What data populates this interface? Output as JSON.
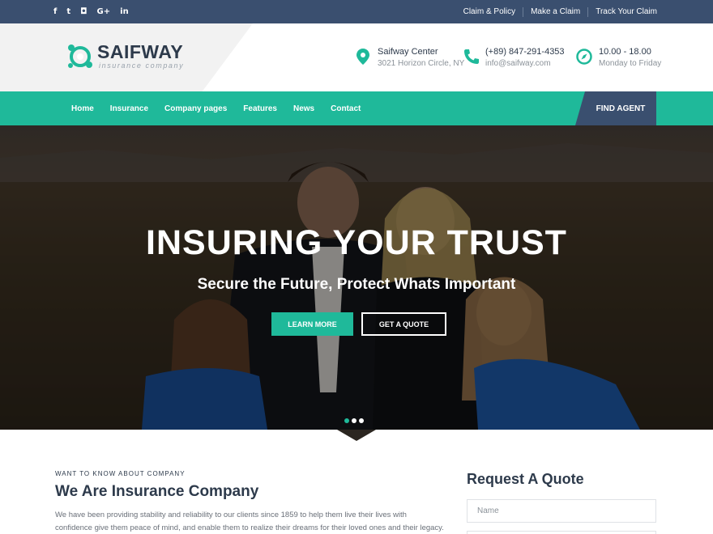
{
  "topbar": {
    "social": [
      {
        "icon": "facebook-icon",
        "glyph": "f"
      },
      {
        "icon": "twitter-icon",
        "glyph": "t"
      },
      {
        "icon": "instagram-icon",
        "glyph": "◘"
      },
      {
        "icon": "google-plus-icon",
        "glyph": "G+"
      },
      {
        "icon": "linkedin-icon",
        "glyph": "in"
      }
    ],
    "links": [
      "Claim & Policy",
      "Make a Claim",
      "Track Your Claim"
    ]
  },
  "header": {
    "logo_name": "SAIFWAY",
    "logo_tagline": "insurance company",
    "address": {
      "icon": "map-pin-icon",
      "line1": "Saifway Center",
      "line2": "3021 Horizon Circle, NY"
    },
    "contact": {
      "icon": "phone-icon",
      "line1": "(+89) 847-291-4353",
      "line2": "info@saifway.com"
    },
    "hours": {
      "icon": "compass-icon",
      "line1": "10.00 - 18.00",
      "line2": "Monday to Friday"
    }
  },
  "nav": {
    "items": [
      "Home",
      "Insurance",
      "Company pages",
      "Features",
      "News",
      "Contact"
    ],
    "cta": "FIND AGENT"
  },
  "hero": {
    "title": "INSURING YOUR TRUST",
    "subtitle": "Secure the Future, Protect Whats Important",
    "primary_button": "LEARN MORE",
    "secondary_button": "GET A QUOTE",
    "slides": 3,
    "active_slide": 1
  },
  "about": {
    "kicker": "WANT TO KNOW ABOUT COMPANY",
    "title": "We Are Insurance Company",
    "body": "We have been providing stability and reliability to our clients since 1859 to help them live their lives with confidence give them peace of mind, and enable them to realize their dreams for their loved ones and their legacy. We have"
  },
  "quote_form": {
    "title": "Request A Quote",
    "name_placeholder": "Name"
  },
  "colors": {
    "accent": "#1fb99a",
    "navy": "#3a4f6f",
    "text_dark": "#2d3a4b"
  }
}
